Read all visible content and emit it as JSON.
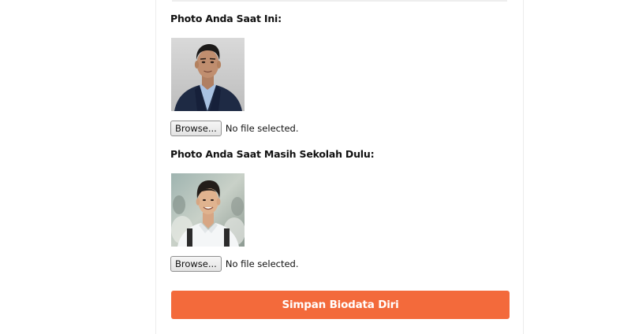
{
  "form": {
    "current_photo_label": "Photo Anda Saat Ini:",
    "school_photo_label": "Photo Anda Saat Masih Sekolah Dulu:",
    "current_photo_input": {
      "button_label": "Browse...",
      "status": "No file selected."
    },
    "school_photo_input": {
      "button_label": "Browse...",
      "status": "No file selected."
    },
    "submit_label": "Simpan Biodata Diri"
  },
  "colors": {
    "accent": "#f36a3b",
    "text": "#111111",
    "background": "#ffffff"
  }
}
